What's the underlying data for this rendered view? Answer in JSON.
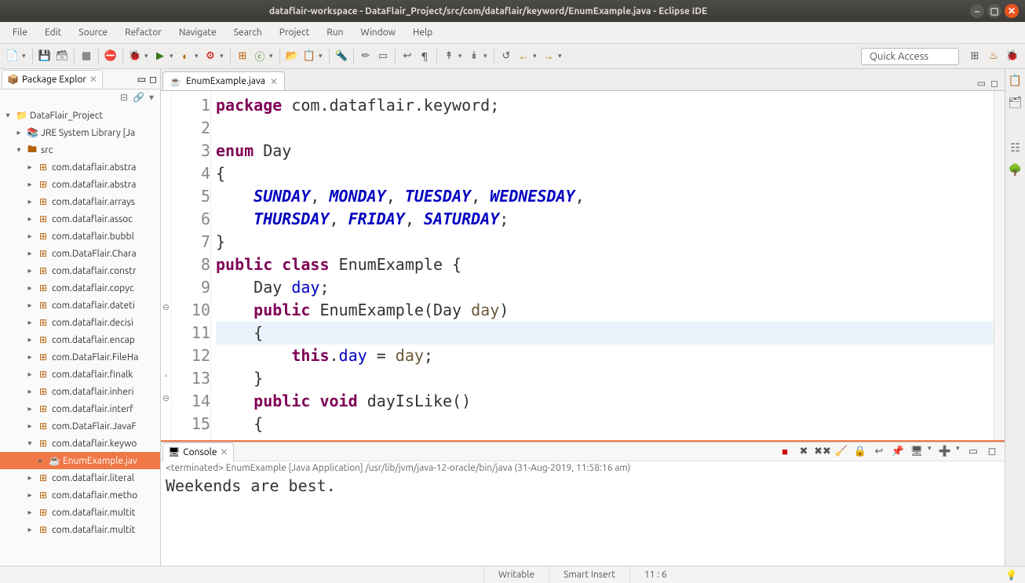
{
  "window": {
    "title": "dataflair-workspace - DataFlair_Project/src/com/dataflair/keyword/EnumExample.java - Eclipse IDE"
  },
  "menu": [
    "File",
    "Edit",
    "Source",
    "Refactor",
    "Navigate",
    "Search",
    "Project",
    "Run",
    "Window",
    "Help"
  ],
  "toolbar": {
    "quick_access": "Quick Access"
  },
  "pkg_explorer": {
    "title": "Package Explor",
    "project": "DataFlair_Project",
    "jre": "JRE System Library [Ja",
    "src": "src",
    "packages": [
      "com.dataflair.abstra",
      "com.dataflair.abstra",
      "com.dataflair.arrays",
      "com.dataflair.assoc",
      "com.dataflair.bubbl",
      "com.DataFlair.Chara",
      "com.dataflair.constr",
      "com.dataflair.copyc",
      "com.dataflair.dateti",
      "com.dataflair.decisi",
      "com.dataflair.encap",
      "com.DataFlair.FileHa",
      "com.dataflair.finalk",
      "com.dataflair.inheri",
      "com.dataflair.interf",
      "com.DataFlair.JavaF",
      "com.dataflair.keywo",
      "com.dataflair.literal",
      "com.dataflair.metho",
      "com.dataflair.multit",
      "com.dataflair.multit"
    ],
    "open_package_index": 16,
    "selected_file": "EnumExample.jav"
  },
  "editor": {
    "tab_title": "EnumExample.java",
    "highlighted_line": 11,
    "lines": [
      {
        "n": 1,
        "html": "<span class='kw'>package</span> com.dataflair.keyword;"
      },
      {
        "n": 2,
        "html": ""
      },
      {
        "n": 3,
        "html": "<span class='kw'>enum</span> Day"
      },
      {
        "n": 4,
        "html": "{"
      },
      {
        "n": 5,
        "html": "    <span class='enumv'>SUNDAY</span>, <span class='enumv'>MONDAY</span>, <span class='enumv'>TUESDAY</span>, <span class='enumv'>WEDNESDAY</span>,"
      },
      {
        "n": 6,
        "html": "    <span class='enumv'>THURSDAY</span>, <span class='enumv'>FRIDAY</span>, <span class='enumv'>SATURDAY</span>;"
      },
      {
        "n": 7,
        "html": "}"
      },
      {
        "n": 8,
        "html": "<span class='kw'>public</span> <span class='kw'>class</span> EnumExample {"
      },
      {
        "n": 9,
        "html": "    Day <span class='field'>day</span>;"
      },
      {
        "n": 10,
        "html": "    <span class='kw'>public</span> EnumExample(Day <span class='param'>day</span>)"
      },
      {
        "n": 11,
        "html": "    {"
      },
      {
        "n": 12,
        "html": "        <span class='kw'>this</span>.<span class='field'>day</span> = <span class='param'>day</span>;"
      },
      {
        "n": 13,
        "html": "    }"
      },
      {
        "n": 14,
        "html": "    <span class='kw'>public</span> <span class='kw'>void</span> dayIsLike()"
      },
      {
        "n": 15,
        "html": "    {"
      }
    ],
    "annotations": {
      "10": "⊖",
      "13": "▫",
      "14": "⊖"
    }
  },
  "console": {
    "title": "Console",
    "status": "<terminated> EnumExample [Java Application] /usr/lib/jvm/java-12-oracle/bin/java (31-Aug-2019, 11:58:16 am)",
    "output": "Weekends are best."
  },
  "statusbar": {
    "writable": "Writable",
    "insert": "Smart Insert",
    "pos": "11 : 6"
  }
}
